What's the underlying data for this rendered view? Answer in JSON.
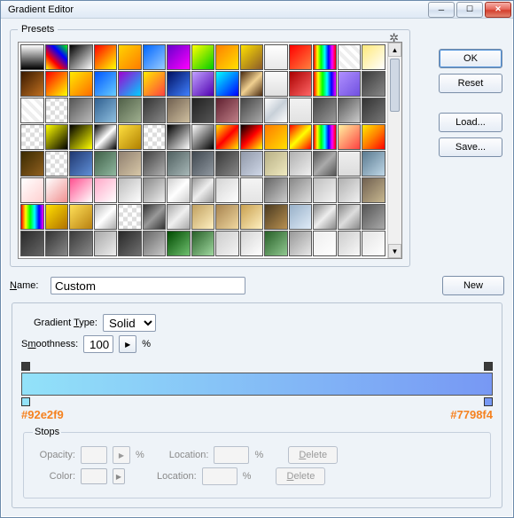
{
  "window": {
    "title": "Gradient Editor"
  },
  "buttons": {
    "ok": "OK",
    "reset": "Reset",
    "load": "Load...",
    "save": "Save...",
    "new": "New",
    "delete": "Delete"
  },
  "labels": {
    "presets": "Presets",
    "name": "Name:",
    "gradientType": "Gradient Type:",
    "smoothness": "Smoothness:",
    "percent": "%",
    "stops": "Stops",
    "opacity": "Opacity:",
    "location": "Location:",
    "color": "Color:"
  },
  "fields": {
    "name": "Custom",
    "gradientType": "Solid",
    "smoothness": "100",
    "opacity": "",
    "location1": "",
    "location2": ""
  },
  "gradient": {
    "left_color": "#92e2f9",
    "right_color": "#7798f4",
    "left_hex": "#92e2f9",
    "right_hex": "#7798f4"
  },
  "swatches": [
    "linear-gradient(#fff,#000)",
    "linear-gradient(45deg,#ff0,#f00,#00f,#0f0)",
    "linear-gradient(135deg,#000,#fff)",
    "linear-gradient(135deg,#f00,#ff0)",
    "linear-gradient(135deg,#ffd400,#ff7b00)",
    "linear-gradient(135deg,#06f,#9cf)",
    "linear-gradient(135deg,#60c,#f0f)",
    "linear-gradient(135deg,#ff0,#0c0)",
    "linear-gradient(135deg,#ff8000,#ffe000)",
    "linear-gradient(135deg,#ffe000,#8a5a2a)",
    "linear-gradient(#fff,#e8e8e8)",
    "linear-gradient(135deg,#f00,#ff8040)",
    "linear-gradient(90deg,#f00,#ff0,#0f0,#0ff,#00f,#f0f,#f00)",
    "repeating-linear-gradient(45deg,#fff,#fff 4px,#eee 4px,#eee 8px)",
    "linear-gradient(135deg,#ffe97a,#fff)",
    "linear-gradient(135deg,#3a1a00,#c07020)",
    "linear-gradient(135deg,#f00,#ff0)",
    "linear-gradient(135deg,#ffea00,#ff6a00)",
    "linear-gradient(135deg,#05f,#6cf)",
    "linear-gradient(135deg,#a000d0,#00d0ff)",
    "linear-gradient(135deg,#ffea00,#ff4040)",
    "linear-gradient(135deg,#001060,#4080ff)",
    "linear-gradient(135deg,#c0a0ff,#5000b0)",
    "linear-gradient(135deg,#0ff,#00f)",
    "linear-gradient(135deg,#4a2a10,#f0d090,#4a2a10)",
    "linear-gradient(#fafafa,#e0e0e0)",
    "linear-gradient(135deg,#a00,#f66)",
    "linear-gradient(90deg,#f00,#ff0,#0f0,#0ff,#00f,#f0f)",
    "linear-gradient(135deg,#b090ff,#7050e0)",
    "linear-gradient(135deg,#3a3a3a,#888)",
    "repeating-linear-gradient(45deg,#fff 0 4px,#eee 4px 8px)",
    "repeating-conic-gradient(#fff 0 25%,#ddd 0 50%) 0/10px 10px",
    "linear-gradient(135deg,#555,#bbb)",
    "linear-gradient(135deg,#306090,#90c0e0)",
    "linear-gradient(135deg,#506048,#a0b090)",
    "linear-gradient(135deg,#333,#888)",
    "linear-gradient(135deg,#706050,#d0c0a0)",
    "linear-gradient(135deg,#222,#555)",
    "linear-gradient(135deg,#602030,#c08088)",
    "linear-gradient(135deg,#444,#aaa)",
    "linear-gradient(135deg,#fff,#c8d0d8,#fff)",
    "linear-gradient(#f2f2f2,#e2e2e2)",
    "linear-gradient(135deg,#444,#999)",
    "linear-gradient(135deg,#555,#ccc)",
    "linear-gradient(135deg,#333,#777)",
    "repeating-conic-gradient(#fff 0 25%,#ddd 0 50%) 0/10px 10px",
    "linear-gradient(135deg,#ff0,#000)",
    "linear-gradient(135deg,#000,#ff0)",
    "linear-gradient(135deg,#000,#fff,#000)",
    "linear-gradient(135deg,#ffe040,#b08000)",
    "repeating-conic-gradient(#fff 0 25%,#ddd 0 50%) 0/10px 10px",
    "linear-gradient(135deg,#000,#fff)",
    "linear-gradient(135deg,#fff,#000)",
    "linear-gradient(135deg,#ffea00,#f00,#ffea00)",
    "linear-gradient(135deg,#000,#f00,#ff0)",
    "linear-gradient(135deg,#ff7a00,#ffe000)",
    "linear-gradient(135deg,#f00,#ff0,#f00)",
    "linear-gradient(90deg,#f00,#ff0,#0f0,#0ff,#00f,#f0f,#f00)",
    "linear-gradient(135deg,#fff2a0,#ff4040)",
    "linear-gradient(135deg,#ffea00,#ff8000,#f00)",
    "linear-gradient(135deg,#3a2a00,#906020)",
    "repeating-conic-gradient(#fff 0 25%,#ddd 0 50%) 0/10px 10px",
    "linear-gradient(135deg,#203870,#6090d8)",
    "linear-gradient(135deg,#406048,#90b8a0)",
    "linear-gradient(135deg,#908070,#d8c8a8)",
    "linear-gradient(135deg,#404040,#b0b0b0)",
    "linear-gradient(135deg,#506060,#a8b8b8)",
    "linear-gradient(135deg,#404850,#9098a0)",
    "linear-gradient(135deg,#383838,#888)",
    "linear-gradient(135deg,#9098a8,#d0d8e8)",
    "linear-gradient(135deg,#b8b086,#f0eac0)",
    "linear-gradient(135deg,#b0b0b0,#f0f0f0)",
    "linear-gradient(135deg,#555,#aaa,#555)",
    "linear-gradient(#efefef,#dcdcdc)",
    "linear-gradient(135deg,#5a7a90,#c0d8e8)",
    "linear-gradient(135deg,#fff,#ffd0d0)",
    "linear-gradient(135deg,#fff,#f09090)",
    "linear-gradient(135deg,#ff5090,#fff)",
    "linear-gradient(135deg,#ffa8c8,#fff)",
    "linear-gradient(135deg,#bbb,#fff)",
    "linear-gradient(135deg,#888,#eee)",
    "linear-gradient(135deg,#ccc,#fff,#ccc)",
    "linear-gradient(135deg,#999,#eee,#999)",
    "linear-gradient(135deg,#d4d4d4,#fff)",
    "linear-gradient(#f4f4f4,#e4e4e4)",
    "linear-gradient(135deg,#666,#ccc)",
    "linear-gradient(135deg,#888,#ddd)",
    "linear-gradient(135deg,#c0c0c0,#f4f4f4)",
    "linear-gradient(135deg,#b0b0b0,#f0f0f0)",
    "linear-gradient(135deg,#706050,#c8b890)",
    "linear-gradient(90deg,#f00,#ff0,#0f0,#0ff,#00f,#f0f)",
    "linear-gradient(135deg,#ffe000,#b07000)",
    "linear-gradient(135deg,#ffe058,#b88010)",
    "linear-gradient(135deg,#bbb,#fff,#aaa)",
    "repeating-conic-gradient(#fff 0 25%,#ddd 0 50%) 0/10px 10px",
    "linear-gradient(135deg,#333,#999,#333)",
    "linear-gradient(135deg,#a8a8a8,#f0f0f0,#a8a8a8)",
    "linear-gradient(135deg,#c0a060,#fff0c0)",
    "linear-gradient(135deg,#a88450,#f0d8a0)",
    "linear-gradient(135deg,#c8a050,#fff0c0)",
    "linear-gradient(135deg,#4a3a20,#b89050)",
    "linear-gradient(135deg,#98b0c8,#e0ecf8)",
    "linear-gradient(135deg,#888,#eee,#888)",
    "linear-gradient(135deg,#888,#ddd,#888)",
    "linear-gradient(135deg,#555,#aaa)",
    "linear-gradient(135deg,#2a2a2a,#666)",
    "linear-gradient(135deg,#333,#888)",
    "linear-gradient(135deg,#3a3a3a,#8a8a8a)",
    "linear-gradient(135deg,#a8a8a8,#eee)",
    "linear-gradient(135deg,#282828,#707070)",
    "linear-gradient(135deg,#666,#c8c8c8)",
    "linear-gradient(135deg,#004a00,#70c070)",
    "linear-gradient(135deg,#286028,#a0d8a0)",
    "linear-gradient(135deg,#ccc,#f4f4f4)",
    "linear-gradient(135deg,#d4d4d4,#fff)",
    "linear-gradient(135deg,#286028,#90c890)",
    "linear-gradient(135deg,#989898,#e8e8e8)",
    "linear-gradient(135deg,#eee,#fff)",
    "linear-gradient(135deg,#ccc,#f8f8f8)",
    "linear-gradient(135deg,#e4e4e4,#fff)"
  ]
}
